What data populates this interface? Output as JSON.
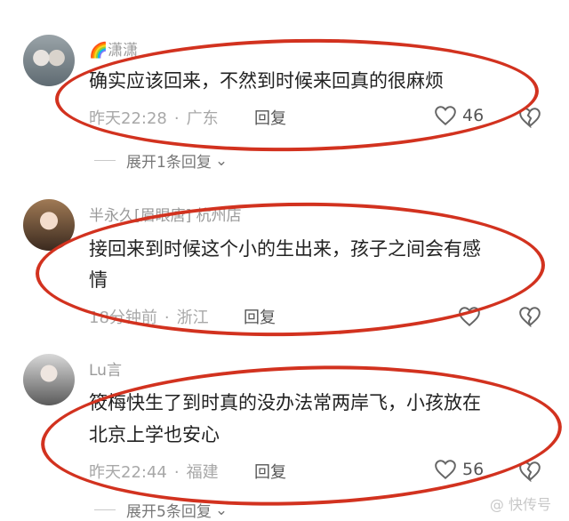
{
  "comments": [
    {
      "username": "🌈潇潇",
      "content": [
        "确实应该回来，不然到时候来回真的很麻烦"
      ],
      "time": "昨天22:28",
      "location": "广东",
      "reply_label": "回复",
      "likes": "46",
      "expand": "展开1条回复"
    },
    {
      "username": "半永久[眉眼唐] 杭州店",
      "content": [
        "接回来到时候这个小的生出来，孩子之间会有感",
        "情"
      ],
      "time": "18分钟前",
      "location": "浙江",
      "reply_label": "回复",
      "likes": "",
      "expand": ""
    },
    {
      "username": "Lu言",
      "content": [
        "筱梅快生了到时真的没办法常两岸飞，小孩放在",
        "北京上学也安心"
      ],
      "time": "昨天22:44",
      "location": "福建",
      "reply_label": "回复",
      "likes": "56",
      "expand": "展开5条回复"
    }
  ],
  "icons": {
    "like": "heart-outline-icon",
    "dislike": "broken-heart-outline-icon",
    "expand": "chevron-down-icon"
  },
  "colors": {
    "annotation": "#d2321f",
    "meta": "#a8a8a8",
    "text": "#222222"
  },
  "watermark": "@ 快传号"
}
